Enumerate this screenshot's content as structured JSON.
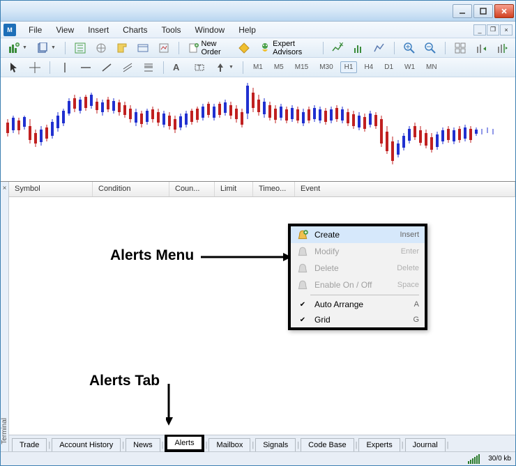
{
  "menu": {
    "items": [
      "File",
      "View",
      "Insert",
      "Charts",
      "Tools",
      "Window",
      "Help"
    ]
  },
  "toolbar1": {
    "new_order": "New Order",
    "expert_advisors": "Expert Advisors"
  },
  "timeframes": [
    "M1",
    "M5",
    "M15",
    "M30",
    "H1",
    "H4",
    "D1",
    "W1",
    "MN"
  ],
  "active_timeframe": "H1",
  "terminal": {
    "label": "Terminal",
    "columns": {
      "symbol": "Symbol",
      "condition": "Condition",
      "counter": "Coun...",
      "limit": "Limit",
      "timeout": "Timeo...",
      "event": "Event"
    }
  },
  "context_menu": {
    "items": [
      {
        "label": "Create",
        "shortcut": "Insert",
        "enabled": true,
        "highlighted": true,
        "icon": "bell-add"
      },
      {
        "label": "Modify",
        "shortcut": "Enter",
        "enabled": false,
        "icon": "bell-edit"
      },
      {
        "label": "Delete",
        "shortcut": "Delete",
        "enabled": false,
        "icon": "bell-delete"
      },
      {
        "label": "Enable On / Off",
        "shortcut": "Space",
        "enabled": false,
        "icon": "bell-toggle"
      },
      {
        "label": "Auto Arrange",
        "shortcut": "A",
        "enabled": true,
        "checked": true
      },
      {
        "label": "Grid",
        "shortcut": "G",
        "enabled": true,
        "checked": true
      }
    ]
  },
  "tabs": [
    "Trade",
    "Account History",
    "News",
    "Alerts",
    "Mailbox",
    "Signals",
    "Code Base",
    "Experts",
    "Journal"
  ],
  "active_tab": "Alerts",
  "status": {
    "traffic": "30/0 kb"
  },
  "annotations": {
    "alerts_menu": "Alerts Menu",
    "alerts_tab": "Alerts Tab"
  },
  "chart_data": {
    "type": "candlestick",
    "note": "OHLC candlestick price chart; individual data values not labeled on axes",
    "series_count": 1,
    "timeframe": "H1"
  }
}
